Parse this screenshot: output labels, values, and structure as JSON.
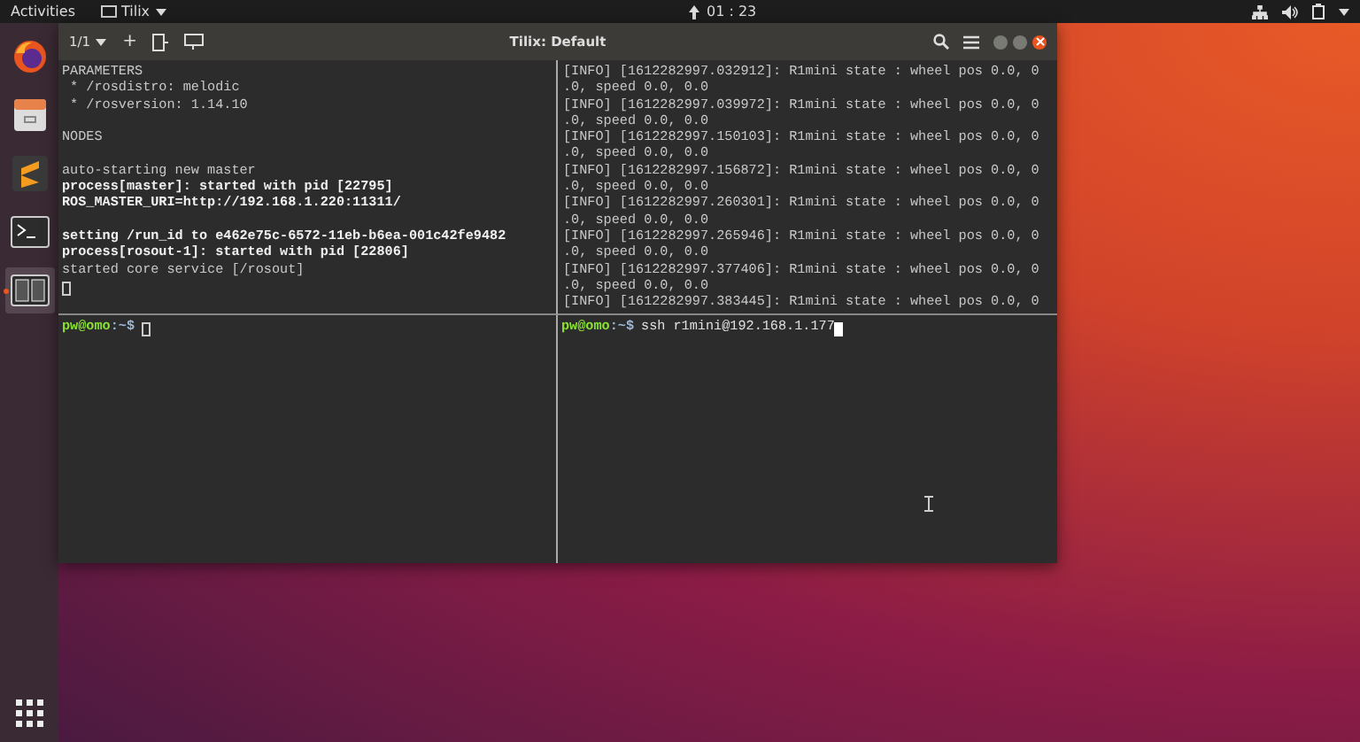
{
  "top_bar": {
    "activities": "Activities",
    "app_menu": "Tilix",
    "clock": "01 : 23"
  },
  "dock": {
    "items": [
      {
        "kind": "firefox",
        "selected": false
      },
      {
        "kind": "files",
        "selected": false
      },
      {
        "kind": "sublime",
        "selected": false
      },
      {
        "kind": "terminal",
        "selected": false
      },
      {
        "kind": "tilix",
        "selected": true
      }
    ]
  },
  "window": {
    "title": "Tilix: Default",
    "session": "1/1",
    "add": "+",
    "panes": [
      {
        "focused": false,
        "cursor": true,
        "lines": [
          {
            "kind": "text",
            "text": "PARAMETERS",
            "bold": false
          },
          {
            "kind": "text",
            "text": " * /rosdistro: melodic",
            "bold": false
          },
          {
            "kind": "text",
            "text": " * /rosversion: 1.14.10",
            "bold": false
          },
          {
            "kind": "blank"
          },
          {
            "kind": "text",
            "text": "NODES",
            "bold": false
          },
          {
            "kind": "blank"
          },
          {
            "kind": "text",
            "text": "auto-starting new master",
            "bold": false
          },
          {
            "kind": "text",
            "text": "process[master]: started with pid [22795]",
            "bold": true
          },
          {
            "kind": "text",
            "text": "ROS_MASTER_URI=http://192.168.1.220:11311/",
            "bold": true
          },
          {
            "kind": "blank"
          },
          {
            "kind": "text",
            "text": "setting /run_id to e462e75c-6572-11eb-b6ea-001c42fe9482",
            "bold": true
          },
          {
            "kind": "text",
            "text": "process[rosout-1]: started with pid [22806]",
            "bold": true
          },
          {
            "kind": "text",
            "text": "started core service [/rosout]",
            "bold": false
          }
        ]
      },
      {
        "lines": [
          {
            "kind": "text",
            "text": "[INFO] [1612282997.032912]: R1mini state : wheel pos 0.0, 0",
            "bold": false
          },
          {
            "kind": "text",
            "text": ".0, speed 0.0, 0.0",
            "bold": false
          },
          {
            "kind": "text",
            "text": "[INFO] [1612282997.039972]: R1mini state : wheel pos 0.0, 0",
            "bold": false
          },
          {
            "kind": "text",
            "text": ".0, speed 0.0, 0.0",
            "bold": false
          },
          {
            "kind": "text",
            "text": "[INFO] [1612282997.150103]: R1mini state : wheel pos 0.0, 0",
            "bold": false
          },
          {
            "kind": "text",
            "text": ".0, speed 0.0, 0.0",
            "bold": false
          },
          {
            "kind": "text",
            "text": "[INFO] [1612282997.156872]: R1mini state : wheel pos 0.0, 0",
            "bold": false
          },
          {
            "kind": "text",
            "text": ".0, speed 0.0, 0.0",
            "bold": false
          },
          {
            "kind": "text",
            "text": "[INFO] [1612282997.260301]: R1mini state : wheel pos 0.0, 0",
            "bold": false
          },
          {
            "kind": "text",
            "text": ".0, speed 0.0, 0.0",
            "bold": false
          },
          {
            "kind": "text",
            "text": "[INFO] [1612282997.265946]: R1mini state : wheel pos 0.0, 0",
            "bold": false
          },
          {
            "kind": "text",
            "text": ".0, speed 0.0, 0.0",
            "bold": false
          },
          {
            "kind": "text",
            "text": "[INFO] [1612282997.377406]: R1mini state : wheel pos 0.0, 0",
            "bold": false
          },
          {
            "kind": "text",
            "text": ".0, speed 0.0, 0.0",
            "bold": false
          },
          {
            "kind": "text",
            "text": "[INFO] [1612282997.383445]: R1mini state : wheel pos 0.0, 0",
            "bold": false
          }
        ]
      },
      {
        "focused": false,
        "prompt": {
          "user_host": "pw@omo",
          "path": ":~$"
        }
      },
      {
        "focused": true,
        "prompt": {
          "user_host": "pw@omo",
          "path": ":~$",
          "command": "ssh r1mini@192.168.1.177"
        }
      }
    ]
  }
}
